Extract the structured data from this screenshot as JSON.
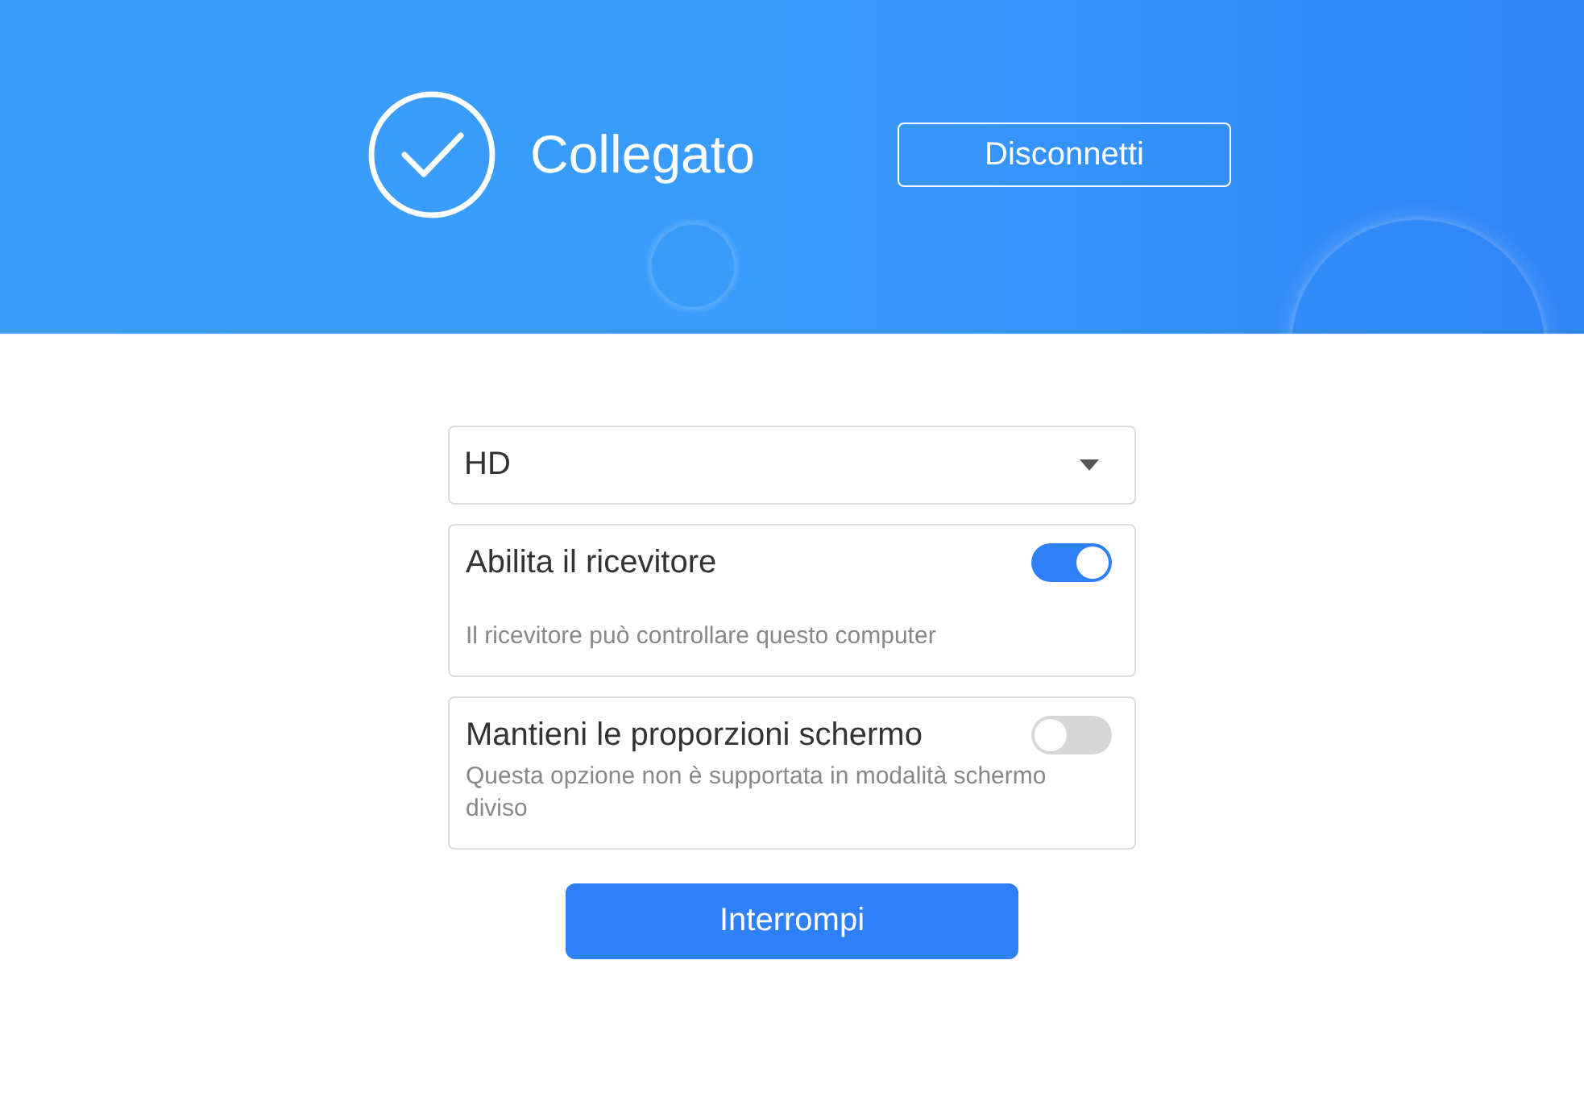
{
  "header": {
    "status": "Collegato",
    "disconnect_button": "Disconnetti"
  },
  "quality_select": {
    "value": "HD"
  },
  "options": [
    {
      "title": "Abilita il ricevitore",
      "on": true,
      "description": "Il ricevitore può controllare questo computer"
    },
    {
      "title": "Mantieni le proporzioni schermo",
      "on": false,
      "description": "Questa opzione non è supportata in modalità schermo diviso"
    }
  ],
  "stop_button": "Interrompi"
}
